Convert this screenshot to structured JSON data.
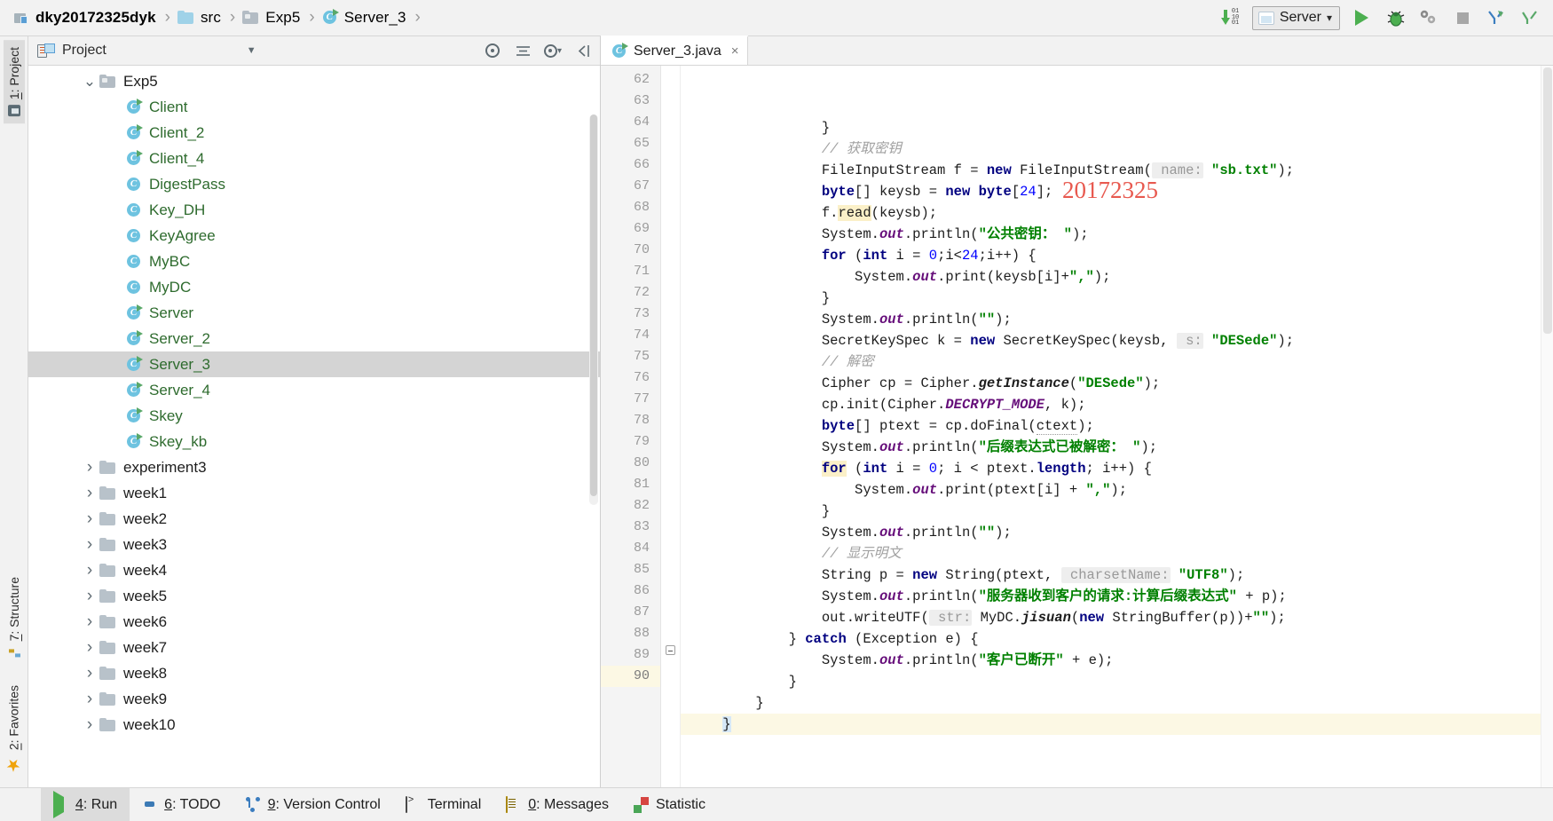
{
  "navbar": {
    "breadcrumbs": [
      {
        "label": "dky20172325dyk",
        "icon": "module-icon"
      },
      {
        "label": "src",
        "icon": "folder-icon"
      },
      {
        "label": "Exp5",
        "icon": "folder-icon"
      },
      {
        "label": "Server_3",
        "icon": "java-class-icon"
      }
    ],
    "separator": "›",
    "download_icon_bits": [
      "01",
      "10",
      "01"
    ],
    "run_config": {
      "label": "Server",
      "chevron": "⌄"
    },
    "buttons": [
      {
        "name": "run-button",
        "label": "Run"
      },
      {
        "name": "debug-button",
        "label": "Debug"
      },
      {
        "name": "coverage-button",
        "label": "Run with Coverage"
      },
      {
        "name": "stop-button",
        "label": "Stop"
      },
      {
        "name": "vcs-update-button",
        "label": "Update Project"
      },
      {
        "name": "vcs-commit-button",
        "label": "Commit"
      }
    ]
  },
  "left_strip": {
    "top_tab": {
      "label_prefix": "1",
      "label": ": Project"
    },
    "bottom_tabs": [
      {
        "label_prefix": "7",
        "label": ": Structure"
      },
      {
        "label_prefix": "2",
        "label": ": Favorites"
      }
    ]
  },
  "project_panel": {
    "title": "Project",
    "dropdown_caret": "▼",
    "toolbar_icons": [
      "locate-icon",
      "collapse-all-icon",
      "settings-gear-icon",
      "hide-panel-icon"
    ],
    "tree": [
      {
        "indent": 1,
        "twist": "∨",
        "icon": "folder-icon-gray",
        "label": "Exp5",
        "kind": "folder",
        "selected": false
      },
      {
        "indent": 2,
        "twist": "",
        "icon": "java-class-runnable-icon",
        "label": "Client",
        "kind": "class",
        "selected": false
      },
      {
        "indent": 2,
        "twist": "",
        "icon": "java-class-runnable-icon",
        "label": "Client_2",
        "kind": "class",
        "selected": false
      },
      {
        "indent": 2,
        "twist": "",
        "icon": "java-class-runnable-icon",
        "label": "Client_4",
        "kind": "class",
        "selected": false
      },
      {
        "indent": 2,
        "twist": "",
        "icon": "java-class-icon",
        "label": "DigestPass",
        "kind": "class",
        "selected": false
      },
      {
        "indent": 2,
        "twist": "",
        "icon": "java-class-icon",
        "label": "Key_DH",
        "kind": "class",
        "selected": false
      },
      {
        "indent": 2,
        "twist": "",
        "icon": "java-class-icon",
        "label": "KeyAgree",
        "kind": "class",
        "selected": false
      },
      {
        "indent": 2,
        "twist": "",
        "icon": "java-class-icon",
        "label": "MyBC",
        "kind": "class",
        "selected": false
      },
      {
        "indent": 2,
        "twist": "",
        "icon": "java-class-icon",
        "label": "MyDC",
        "kind": "class",
        "selected": false
      },
      {
        "indent": 2,
        "twist": "",
        "icon": "java-class-runnable-icon",
        "label": "Server",
        "kind": "class",
        "selected": false
      },
      {
        "indent": 2,
        "twist": "",
        "icon": "java-class-runnable-icon",
        "label": "Server_2",
        "kind": "class",
        "selected": false
      },
      {
        "indent": 2,
        "twist": "",
        "icon": "java-class-runnable-icon",
        "label": "Server_3",
        "kind": "class",
        "selected": true
      },
      {
        "indent": 2,
        "twist": "",
        "icon": "java-class-runnable-icon",
        "label": "Server_4",
        "kind": "class",
        "selected": false
      },
      {
        "indent": 2,
        "twist": "",
        "icon": "java-class-runnable-icon",
        "label": "Skey",
        "kind": "class",
        "selected": false
      },
      {
        "indent": 2,
        "twist": "",
        "icon": "java-class-runnable-icon",
        "label": "Skey_kb",
        "kind": "class",
        "selected": false
      },
      {
        "indent": 1,
        "twist": "›",
        "icon": "folder-icon",
        "label": "experiment3",
        "kind": "folder",
        "selected": false
      },
      {
        "indent": 1,
        "twist": "›",
        "icon": "folder-icon",
        "label": "week1",
        "kind": "folder",
        "selected": false
      },
      {
        "indent": 1,
        "twist": "›",
        "icon": "folder-icon",
        "label": "week2",
        "kind": "folder",
        "selected": false
      },
      {
        "indent": 1,
        "twist": "›",
        "icon": "folder-icon",
        "label": "week3",
        "kind": "folder",
        "selected": false
      },
      {
        "indent": 1,
        "twist": "›",
        "icon": "folder-icon",
        "label": "week4",
        "kind": "folder",
        "selected": false
      },
      {
        "indent": 1,
        "twist": "›",
        "icon": "folder-icon",
        "label": "week5",
        "kind": "folder",
        "selected": false
      },
      {
        "indent": 1,
        "twist": "›",
        "icon": "folder-icon",
        "label": "week6",
        "kind": "folder",
        "selected": false
      },
      {
        "indent": 1,
        "twist": "›",
        "icon": "folder-icon",
        "label": "week7",
        "kind": "folder",
        "selected": false
      },
      {
        "indent": 1,
        "twist": "›",
        "icon": "folder-icon",
        "label": "week8",
        "kind": "folder",
        "selected": false
      },
      {
        "indent": 1,
        "twist": "›",
        "icon": "folder-icon",
        "label": "week9",
        "kind": "folder",
        "selected": false
      },
      {
        "indent": 1,
        "twist": "›",
        "icon": "folder-icon",
        "label": "week10",
        "kind": "folder",
        "selected": false
      }
    ]
  },
  "editor": {
    "tab": {
      "label": "Server_3.java",
      "icon": "java-class-runnable-icon",
      "close": "×"
    },
    "watermark": "20172325",
    "first_line_number": 62,
    "current_line": 90,
    "lines": [
      {
        "n": 62,
        "html": "                }"
      },
      {
        "n": 63,
        "html": "                <span class='cmt'>// 获取密钥</span>"
      },
      {
        "n": 64,
        "html": "                FileInputStream f = <span class='kw'>new</span> FileInputStream(<span class='hint'> name:</span> <span class='str'>\"sb.txt\"</span>);"
      },
      {
        "n": 65,
        "html": "                <span class='kw'>byte</span>[] keysb = <span class='kw'>new</span> <span class='kw'>byte</span>[<span class='num'>24</span>];"
      },
      {
        "n": 66,
        "html": "                f.<span class='hl'>read</span>(keysb);"
      },
      {
        "n": 67,
        "html": "                System.<span class='field'>out</span>.println(<span class='str'>\"公共密钥： \"</span>);"
      },
      {
        "n": 68,
        "html": "                <span class='kw'>for</span> (<span class='kw'>int</span> i = <span class='num'>0</span>;i&lt;<span class='num'>24</span>;i++) {"
      },
      {
        "n": 69,
        "html": "                    System.<span class='field'>out</span>.print(keysb[i]+<span class='str'>\",\"</span>);"
      },
      {
        "n": 70,
        "html": "                }"
      },
      {
        "n": 71,
        "html": "                System.<span class='field'>out</span>.println(<span class='str'>\"\"</span>);"
      },
      {
        "n": 72,
        "html": "                SecretKeySpec k = <span class='kw'>new</span> SecretKeySpec(keysb, <span class='hint'> s:</span> <span class='str'>\"DESede\"</span>);"
      },
      {
        "n": 73,
        "html": "                <span class='cmt'>// 解密</span>"
      },
      {
        "n": 74,
        "html": "                Cipher cp = Cipher.<span class='ital'>getInstance</span>(<span class='str'>\"DESede\"</span>);"
      },
      {
        "n": 75,
        "html": "                cp.init(Cipher.<span class='stat'>DECRYPT_MODE</span>, k);"
      },
      {
        "n": 76,
        "html": "                <span class='kw'>byte</span>[] ptext = cp.doFinal(<span class='underl'>ctext</span>);"
      },
      {
        "n": 77,
        "html": "                System.<span class='field'>out</span>.println(<span class='str'>\"后缀表达式已被解密： \"</span>);"
      },
      {
        "n": 78,
        "html": "                <span class='kw hl'>for</span> (<span class='kw'>int</span> i = <span class='num'>0</span>; i &lt; ptext.<span class='kw'>length</span>; i++) {"
      },
      {
        "n": 79,
        "html": "                    System.<span class='field'>out</span>.print(ptext[i] + <span class='str'>\",\"</span>);"
      },
      {
        "n": 80,
        "html": "                }"
      },
      {
        "n": 81,
        "html": "                System.<span class='field'>out</span>.println(<span class='str'>\"\"</span>);"
      },
      {
        "n": 82,
        "html": "                <span class='cmt'>// 显示明文</span>"
      },
      {
        "n": 83,
        "html": "                String p = <span class='kw'>new</span> String(ptext, <span class='hint'> charsetName:</span> <span class='str'>\"UTF8\"</span>);"
      },
      {
        "n": 84,
        "html": "                System.<span class='field'>out</span>.println(<span class='str'>\"服务器收到客户的请求:计算后缀表达式\"</span> + p);"
      },
      {
        "n": 85,
        "html": "                out.writeUTF(<span class='hint'> str:</span> MyDC.<span class='ital'>jisuan</span>(<span class='kw'>new</span> StringBuffer(p))+<span class='str'>\"\"</span>);"
      },
      {
        "n": 86,
        "html": "            } <span class='kw'>catch</span> (Exception e) {"
      },
      {
        "n": 87,
        "html": "                System.<span class='field'>out</span>.println(<span class='str'>\"客户已断开\"</span> + e);"
      },
      {
        "n": 88,
        "html": "            }"
      },
      {
        "n": 89,
        "html": "        }"
      },
      {
        "n": 90,
        "html": "    }"
      }
    ]
  },
  "statusbar": {
    "items": [
      {
        "key": "4",
        "label": ": Run",
        "icon": "run-icon",
        "active": true
      },
      {
        "key": "6",
        "label": ": TODO",
        "icon": "todo-icon",
        "active": false
      },
      {
        "key": "9",
        "label": ": Version Control",
        "icon": "vcs-icon",
        "active": false
      },
      {
        "key": "",
        "label": "Terminal",
        "icon": "terminal-icon",
        "active": false
      },
      {
        "key": "0",
        "label": ": Messages",
        "icon": "messages-icon",
        "active": false
      },
      {
        "key": "",
        "label": "Statistic",
        "icon": "statistic-icon",
        "active": false
      }
    ]
  },
  "colors": {
    "accent_green": "#4caf50",
    "selection_gray": "#d4d4d4",
    "watermark_red": "#e8594f",
    "string_green": "#008000",
    "keyword_navy": "#000080"
  }
}
